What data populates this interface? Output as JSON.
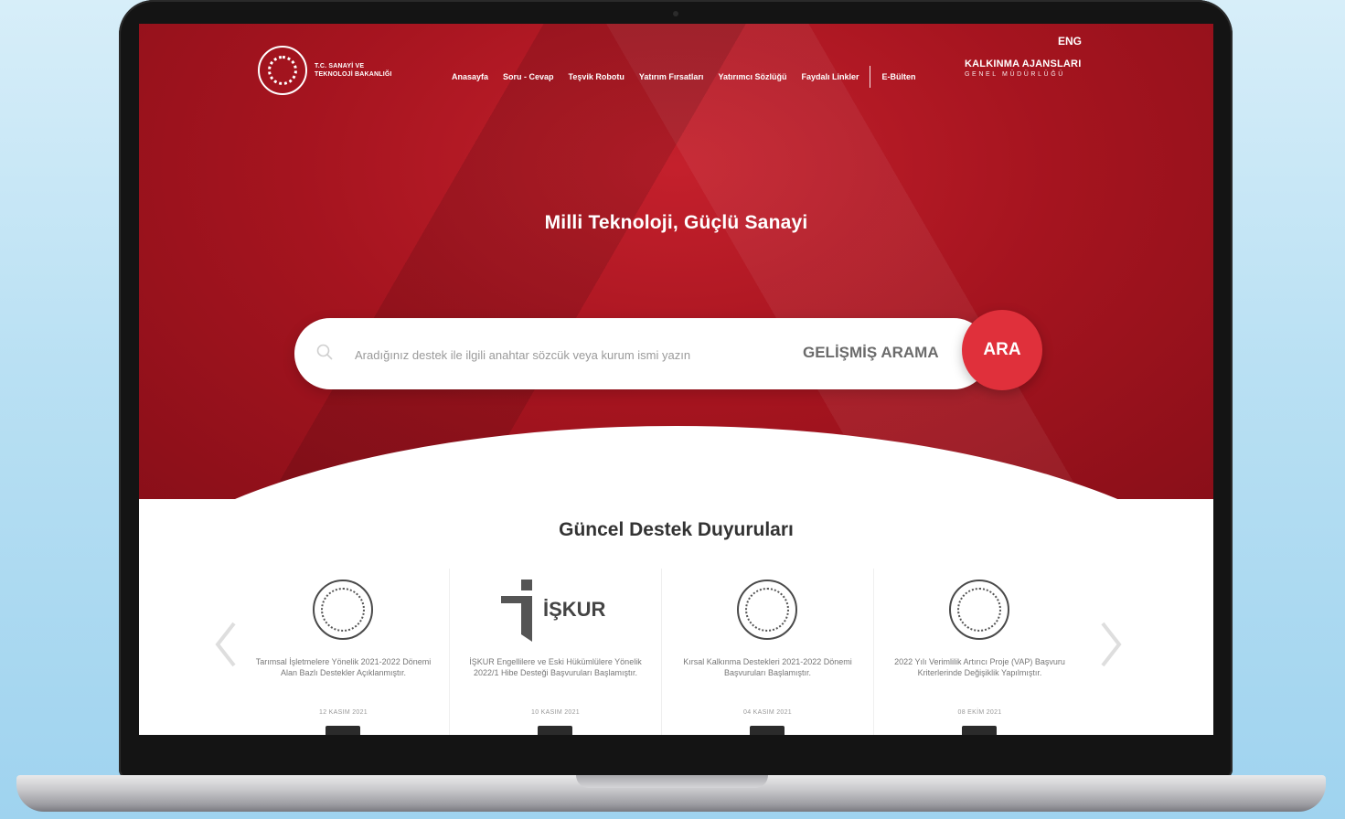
{
  "header": {
    "lang": "ENG",
    "logo_line1": "T.C. SANAYİ VE",
    "logo_line2": "TEKNOLOJİ BAKANLIĞI",
    "nav": [
      "Anasayfa",
      "Soru - Cevap",
      "Teşvik Robotu",
      "Yatırım Fırsatları",
      "Yatırımcı Sözlüğü",
      "Faydalı Linkler"
    ],
    "ebulten": "E-Bülten",
    "agency_line1": "KALKINMA AJANSLARI",
    "agency_line2": "GENEL MÜDÜRLÜĞÜ"
  },
  "hero": {
    "title": "Milli Teknoloji, Güçlü Sanayi",
    "search_placeholder": "Aradığınız destek ile ilgili anahtar sözcük veya kurum ismi yazın",
    "advanced_label": "GELİŞMİŞ ARAMA",
    "search_button": "ARA"
  },
  "announcements": {
    "title": "Güncel Destek Duyuruları",
    "items": [
      {
        "logo": "ministry-seal-icon",
        "text": "Tarımsal İşletmelere Yönelik 2021-2022 Dönemi Alan Bazlı Destekler Açıklanmıştır.",
        "date": "12 KASIM 2021"
      },
      {
        "logo": "iskur-logo",
        "brand": "İŞKUR",
        "text": "İŞKUR Engellilere ve Eski Hükümlülere Yönelik 2022/1 Hibe Desteği Başvuruları Başlamıştır.",
        "date": "10 KASIM 2021"
      },
      {
        "logo": "ministry-seal-icon",
        "text": "Kırsal Kalkınma Destekleri 2021-2022 Dönemi Başvuruları Başlamıştır.",
        "date": "04 KASIM 2021"
      },
      {
        "logo": "ministry-seal-icon",
        "text": "2022 Yılı Verimlilik Artırıcı Proje (VAP) Başvuru Kriterlerinde Değişiklik Yapılmıştır.",
        "date": "08 EKİM 2021"
      }
    ]
  },
  "colors": {
    "hero_red": "#a5141f",
    "accent_red": "#e0303b"
  }
}
